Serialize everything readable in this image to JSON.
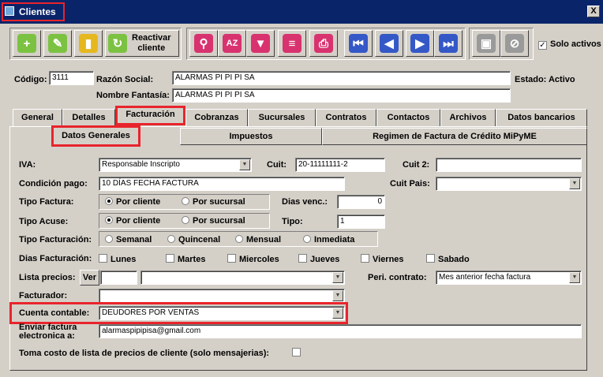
{
  "window": {
    "title": "Clientes",
    "close": "X"
  },
  "toolbar": {
    "reactivar_label_1": "Reactivar",
    "reactivar_label_2": "cliente",
    "solo_activos_label": "Solo activos",
    "solo_activos_checked": "✓"
  },
  "header": {
    "codigo_label": "Código:",
    "codigo_value": "3111",
    "razon_label": "Razón Social:",
    "razon_value": "ALARMAS PI PI PI SA",
    "fantasia_label": "Nombre Fantasía:",
    "fantasia_value": "ALARMAS PI PI PI SA",
    "estado": "Estado: Activo"
  },
  "tabs": [
    "General",
    "Detalles",
    "Facturación",
    "Cobranzas",
    "Sucursales",
    "Contratos",
    "Contactos",
    "Archivos",
    "Datos bancarios"
  ],
  "subtabs": [
    "Datos Generales",
    "Impuestos",
    "Regimen de Factura de Crédito MiPyME"
  ],
  "form": {
    "iva_label": "IVA:",
    "iva_value": "Responsable Inscripto",
    "cuit_label": "Cuit:",
    "cuit_value": "20-11111111-2",
    "cuit2_label": "Cuit 2:",
    "condicion_label": "Condición pago:",
    "condicion_value": "10 DÍAS FECHA FACTURA",
    "cuit_pais_label": "Cuit Pais:",
    "tipo_factura_label": "Tipo Factura:",
    "por_cliente": "Por cliente",
    "por_sucursal": "Por sucursal",
    "dias_venc_label": "Dias venc.:",
    "dias_venc_value": "0",
    "tipo_acuse_label": "Tipo Acuse:",
    "tipo_label": "Tipo:",
    "tipo_value": "1",
    "tipo_facturacion_label": "Tipo Facturación:",
    "semanal": "Semanal",
    "quincenal": "Quincenal",
    "mensual": "Mensual",
    "inmediata": "Inmediata",
    "dias_facturacion_label": "Dias Facturación:",
    "lunes": "Lunes",
    "martes": "Martes",
    "miercoles": "Miercoles",
    "jueves": "Jueves",
    "viernes": "Viernes",
    "sabado": "Sabado",
    "lista_precios_label": "Lista precios:",
    "ver_label": "Ver",
    "peri_contrato_label": "Peri. contrato:",
    "peri_contrato_value": "Mes anterior fecha factura",
    "facturador_label": "Facturador:",
    "cuenta_label": "Cuenta contable:",
    "cuenta_value": "DEUDORES POR VENTAS",
    "enviar_label_1": "Enviar factura",
    "enviar_label_2": "electronica a:",
    "enviar_value": "alarmaspipipisa@gmail.com",
    "toma_costo_label": "Toma costo de lista de precios de cliente (solo mensajerias):"
  }
}
